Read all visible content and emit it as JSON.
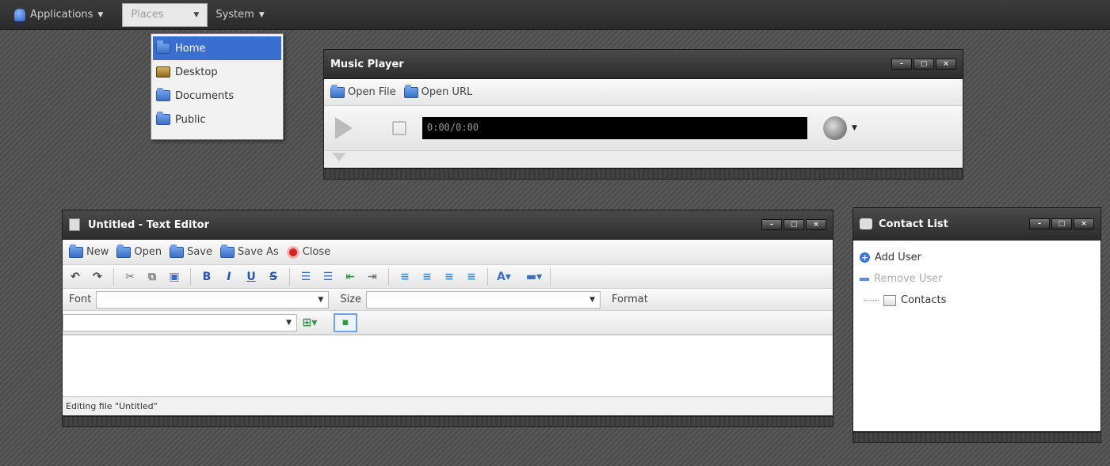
{
  "panel": {
    "menus": [
      {
        "label": "Applications"
      },
      {
        "label": "Places"
      },
      {
        "label": "System"
      }
    ]
  },
  "places_menu": {
    "items": [
      {
        "label": "Home",
        "icon": "home-folder-icon"
      },
      {
        "label": "Desktop",
        "icon": "desktop-icon"
      },
      {
        "label": "Documents",
        "icon": "folder-icon"
      },
      {
        "label": "Public",
        "icon": "folder-icon"
      }
    ]
  },
  "music_player": {
    "title": "Music Player",
    "toolbar": {
      "open_file": "Open File",
      "open_url": "Open URL"
    },
    "time": "0:00/0:00"
  },
  "text_editor": {
    "title": "Untitled - Text Editor",
    "toolbar": {
      "new": "New",
      "open": "Open",
      "save": "Save",
      "save_as": "Save As",
      "close": "Close"
    },
    "font_label": "Font",
    "size_label": "Size",
    "format_label": "Format",
    "status": "Editing file \"Untitled\""
  },
  "contact_list": {
    "title": "Contact List",
    "add_user": "Add User",
    "remove_user": "Remove User",
    "contacts": "Contacts"
  },
  "colors": {
    "selection": "#3a6fd0",
    "panel": "#2f2f2f",
    "title_bar": "#333333"
  }
}
